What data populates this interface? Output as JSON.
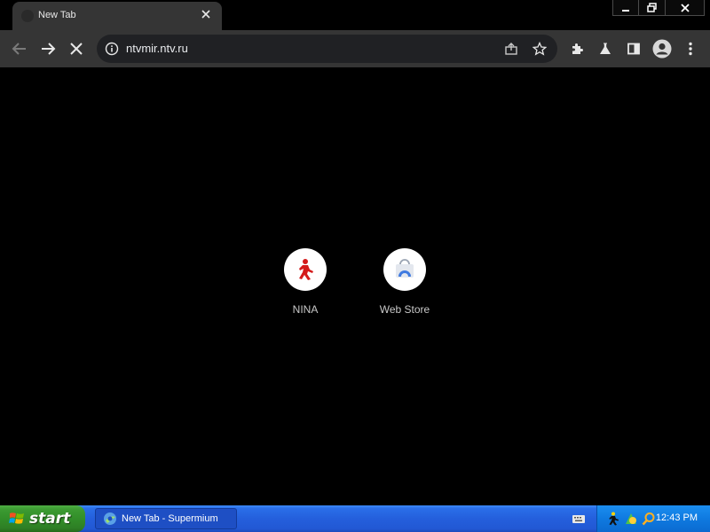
{
  "browser": {
    "tab": {
      "title": "New Tab",
      "favicon": "blank-favicon-icon",
      "close_icon": "close-icon"
    },
    "window_controls": [
      "minimize-icon",
      "restore-icon",
      "close-icon"
    ],
    "toolbar": {
      "icons": [
        "back-arrow-icon",
        "forward-arrow-icon",
        "stop-loading-icon",
        "extensions-puzzle-icon",
        "labs-flask-icon",
        "side-panel-icon",
        "profile-avatar-icon",
        "more-menu-icon"
      ],
      "url": "ntvmir.ntv.ru",
      "omnibox_icons": [
        "site-info-icon",
        "share-icon",
        "bookmark-star-icon"
      ]
    }
  },
  "new_tab": {
    "shortcuts": [
      {
        "label": "NINA",
        "icon": "aim-running-man-icon"
      },
      {
        "label": "Web Store",
        "icon": "web-store-icon"
      }
    ]
  },
  "taskbar": {
    "start_label": "start",
    "task_button_label": "New Tab - Supermium",
    "clock": "12:43 PM",
    "tray_icons": [
      "aim-running-man-icon",
      "network-icon",
      "search-icon"
    ],
    "colors": {
      "taskbar": "#245fdc",
      "start_button": "#318c28",
      "tray": "#0f7ae0"
    }
  },
  "colors": {
    "page_background": "#000000",
    "chrome_background": "#353535",
    "omnibox_background": "#202124"
  }
}
